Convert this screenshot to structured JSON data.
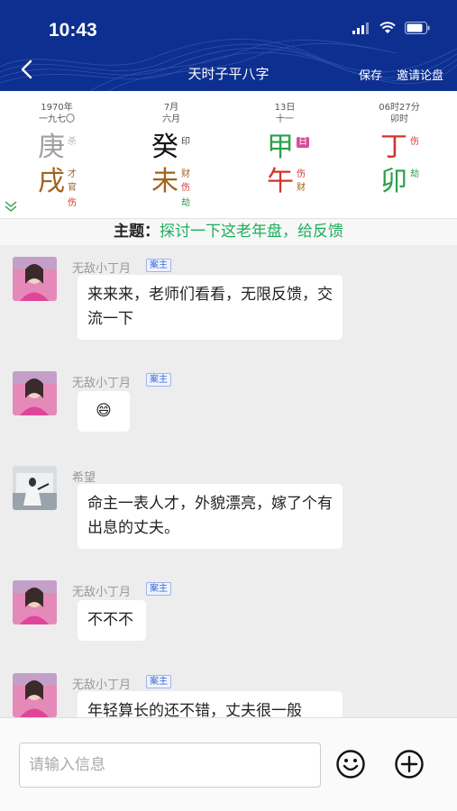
{
  "status": {
    "time": "10:43"
  },
  "nav": {
    "back_icon": "chevron-left-icon",
    "title": "天时子平八字",
    "save": "保存",
    "invite": "邀请论盘"
  },
  "bazi": {
    "pillars": [
      {
        "date1": "1970年",
        "date2": "一九七〇",
        "stem": "庚",
        "stem_color": "#a0a0a0",
        "stem_tag": "杀",
        "stem_tag_color": "#b0b0b0",
        "branch": "戌",
        "branch_color": "#a0621e",
        "branch_tags": [
          "才",
          "官",
          "伤"
        ],
        "branch_tag_colors": [
          "#a0621e",
          "#a0621e",
          "#d0342c"
        ]
      },
      {
        "date1": "7月",
        "date2": "六月",
        "stem": "癸",
        "stem_color": "#111111",
        "stem_tag": "印",
        "stem_tag_color": "#444444",
        "branch": "未",
        "branch_color": "#a0621e",
        "branch_tags": [
          "财",
          "伤",
          "劫"
        ],
        "branch_tag_colors": [
          "#a0621e",
          "#d0342c",
          "#2aa04a"
        ]
      },
      {
        "date1": "13日",
        "date2": "十一",
        "stem": "甲",
        "stem_color": "#2aa04a",
        "stem_tag": "日",
        "stem_tag_color": "#ffffff",
        "branch": "午",
        "branch_color": "#d0342c",
        "branch_tags": [
          "伤",
          "财"
        ],
        "branch_tag_colors": [
          "#d0342c",
          "#a0621e"
        ]
      },
      {
        "date1": "06时27分",
        "date2": "卯时",
        "stem": "丁",
        "stem_color": "#d0342c",
        "stem_tag": "伤",
        "stem_tag_color": "#d0342c",
        "branch": "卯",
        "branch_color": "#2aa04a",
        "branch_tags": [
          "劫"
        ],
        "branch_tag_colors": [
          "#2aa04a"
        ]
      }
    ]
  },
  "topic": {
    "label": "主题：",
    "text": "探讨一下这老年盘，给反馈"
  },
  "messages": [
    {
      "user": "无敌小丁月",
      "badge": "案主",
      "text": "来来来，老师们看看，无限反馈，交流一下"
    },
    {
      "user": "无敌小丁月",
      "badge": "案主",
      "text": "😄"
    },
    {
      "user": "希望",
      "badge": "",
      "text": "命主一表人才，外貌漂亮，嫁了个有出息的丈夫。"
    },
    {
      "user": "无敌小丁月",
      "badge": "案主",
      "text": "不不不"
    },
    {
      "user": "无敌小丁月",
      "badge": "案主",
      "text": "年轻算长的还不错，丈夫很一般"
    }
  ],
  "input": {
    "placeholder": "请输入信息",
    "emoji_icon": "smiley-icon",
    "plus_icon": "plus-circle-icon"
  }
}
